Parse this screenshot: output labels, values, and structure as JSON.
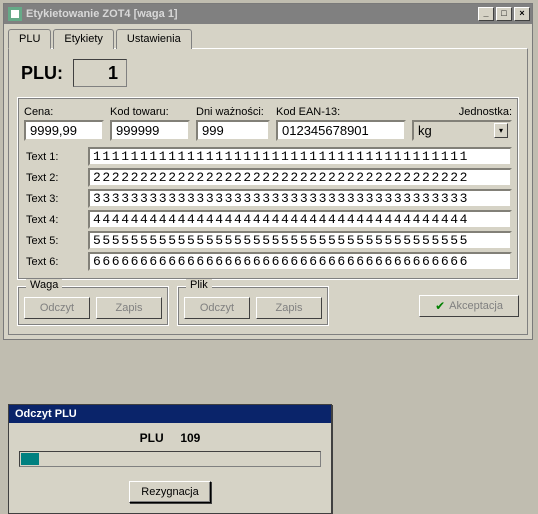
{
  "window": {
    "title": "Etykietowanie ZOT4 [waga 1]"
  },
  "tabs": [
    {
      "label": "PLU"
    },
    {
      "label": "Etykiety"
    },
    {
      "label": "Ustawienia"
    }
  ],
  "plu_header": {
    "label": "PLU:",
    "value": "1"
  },
  "fields": {
    "cena": {
      "label": "Cena:",
      "value": "9999,99"
    },
    "kod": {
      "label": "Kod towaru:",
      "value": "999999"
    },
    "dni": {
      "label": "Dni ważności:",
      "value": "999"
    },
    "ean": {
      "label": "Kod EAN-13:",
      "value": "012345678901"
    },
    "jedn": {
      "label": "Jednostka:",
      "value": "kg"
    }
  },
  "text_lines": [
    {
      "label": "Text 1:",
      "value": "1111111111111111111111111111111111111111"
    },
    {
      "label": "Text 2:",
      "value": "2222222222222222222222222222222222222222"
    },
    {
      "label": "Text 3:",
      "value": "3333333333333333333333333333333333333333"
    },
    {
      "label": "Text 4:",
      "value": "4444444444444444444444444444444444444444"
    },
    {
      "label": "Text 5:",
      "value": "5555555555555555555555555555555555555555"
    },
    {
      "label": "Text 6:",
      "value": "6666666666666666666666666666666666666666"
    }
  ],
  "groups": {
    "waga": {
      "legend": "Waga",
      "odczyt": "Odczyt",
      "zapis": "Zapis"
    },
    "plik": {
      "legend": "Plik",
      "odczyt": "Odczyt",
      "zapis": "Zapis"
    },
    "accept": "Akceptacja"
  },
  "dialog": {
    "title": "Odczyt PLU",
    "label_plu": "PLU",
    "label_val": "109",
    "progress_pct": 6,
    "cancel": "Rezygnacja"
  }
}
